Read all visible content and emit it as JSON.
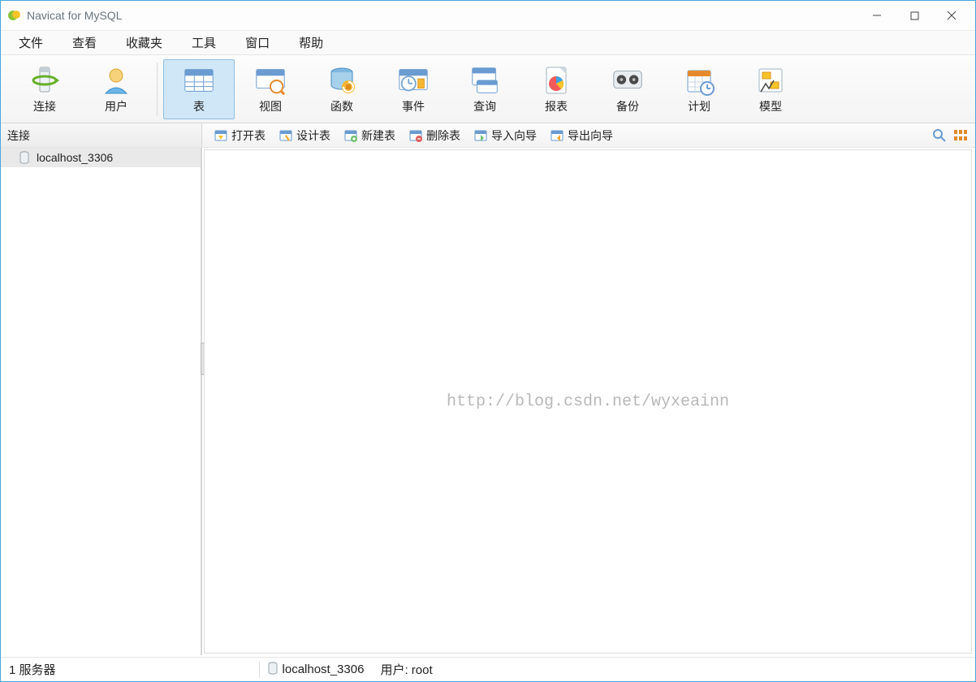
{
  "title": "Navicat for MySQL",
  "menu": [
    "文件",
    "查看",
    "收藏夹",
    "工具",
    "窗口",
    "帮助"
  ],
  "toolbar": {
    "items": [
      {
        "label": "连接",
        "icon": "connection"
      },
      {
        "label": "用户",
        "icon": "user"
      },
      {
        "label": "表",
        "icon": "table",
        "active": true
      },
      {
        "label": "视图",
        "icon": "view"
      },
      {
        "label": "函数",
        "icon": "function"
      },
      {
        "label": "事件",
        "icon": "event"
      },
      {
        "label": "查询",
        "icon": "query"
      },
      {
        "label": "报表",
        "icon": "report"
      },
      {
        "label": "备份",
        "icon": "backup"
      },
      {
        "label": "计划",
        "icon": "schedule"
      },
      {
        "label": "模型",
        "icon": "model"
      }
    ],
    "groups": [
      [
        0,
        1
      ],
      [
        2,
        3,
        4,
        5,
        6,
        7,
        8,
        9,
        10
      ]
    ]
  },
  "subrow": {
    "left_label": "连接",
    "buttons": [
      {
        "label": "打开表",
        "icon": "open"
      },
      {
        "label": "设计表",
        "icon": "design"
      },
      {
        "label": "新建表",
        "icon": "new"
      },
      {
        "label": "删除表",
        "icon": "delete"
      },
      {
        "label": "导入向导",
        "icon": "import"
      },
      {
        "label": "导出向导",
        "icon": "export"
      }
    ]
  },
  "sidebar": {
    "items": [
      "localhost_3306"
    ]
  },
  "watermark": "http://blog.csdn.net/wyxeainn",
  "status": {
    "servers": "1 服务器",
    "connection": "localhost_3306",
    "user_label": "用户: root"
  }
}
